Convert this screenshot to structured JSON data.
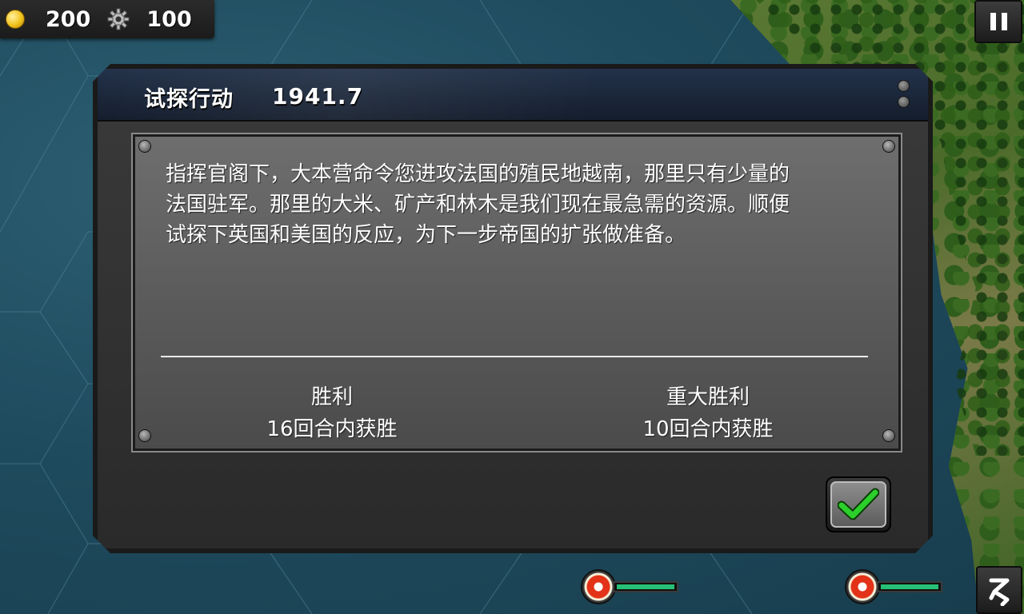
{
  "hud": {
    "gold_icon": "gold-coin-icon",
    "gold": "200",
    "industry_icon": "gear-icon",
    "industry": "100"
  },
  "controls": {
    "pause_icon": "pause-icon",
    "menu_icon": "menu-icon"
  },
  "dialog": {
    "title": "试探行动",
    "year": "1941.7",
    "briefing_lines": [
      "指挥官阁下，大本营命令您进攻法国的殖民地越南，那里只有少量的",
      "法国驻军。那里的大米、矿产和林木是我们现在最急需的资源。顺便",
      "试探下英国和美国的反应，为下一步帝国的扩张做准备。"
    ],
    "victory": {
      "label": "胜利",
      "condition": "16回合内获胜"
    },
    "major_victory": {
      "label": "重大胜利",
      "condition": "10回合内获胜"
    },
    "confirm_icon": "checkmark-icon"
  },
  "colors": {
    "accent_green": "#2bd02a",
    "hp_bar": "#26c076",
    "header_blue": "#1c2a40"
  }
}
